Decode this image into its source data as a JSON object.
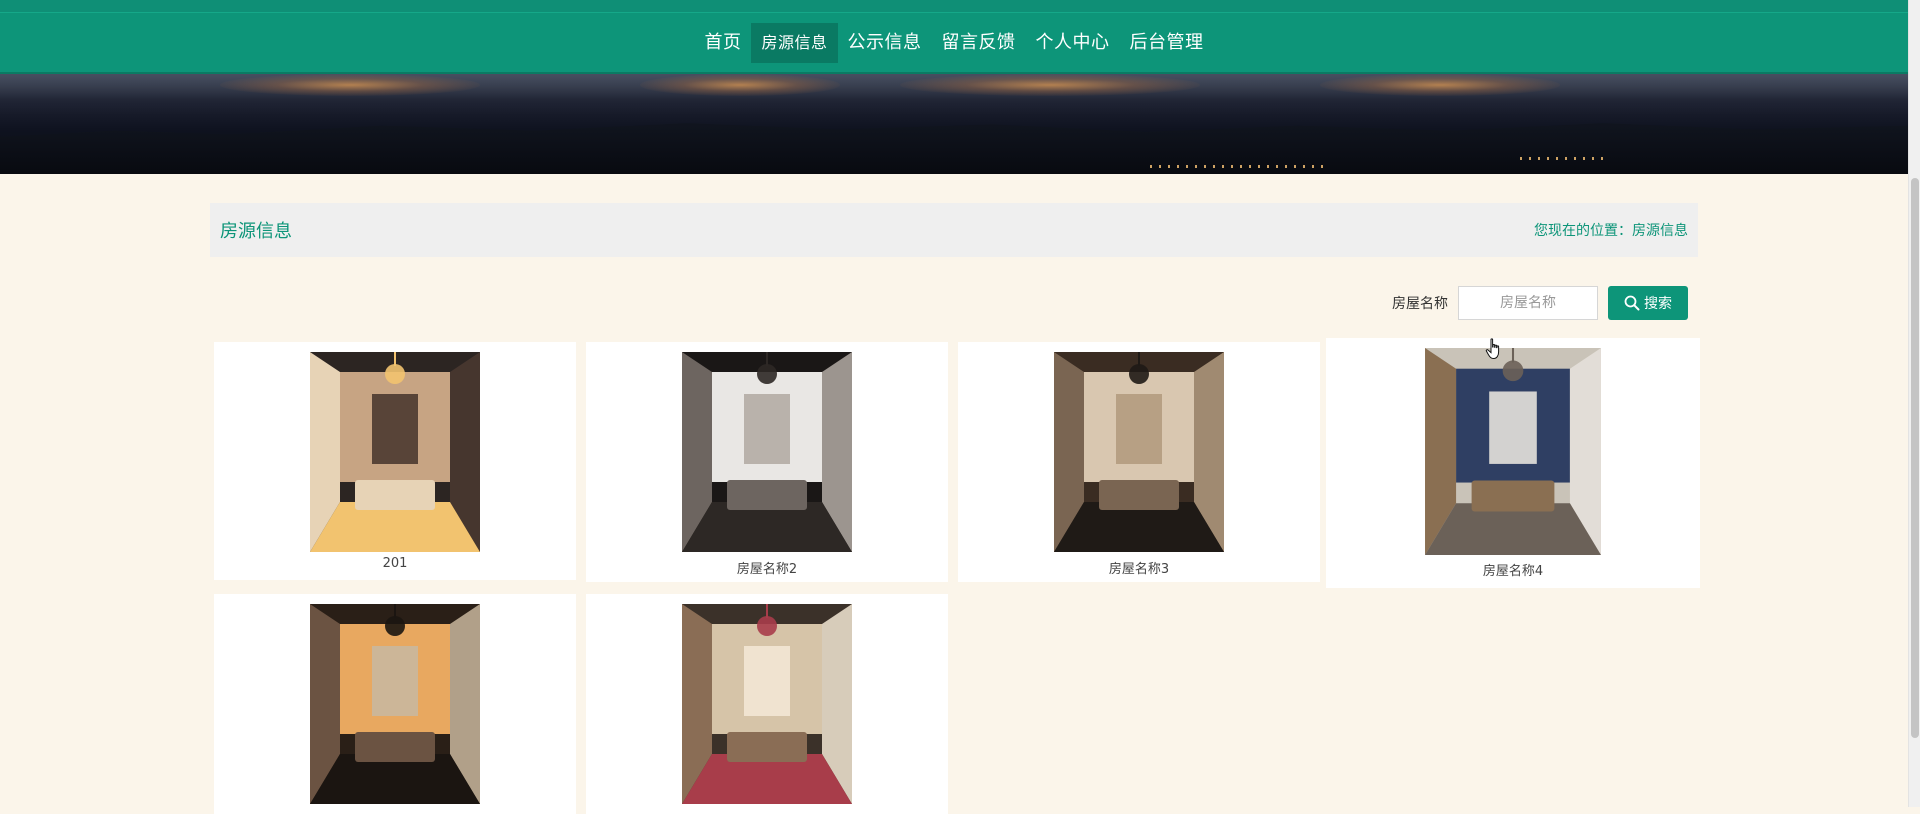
{
  "nav": {
    "items": [
      {
        "label": "首页",
        "active": false
      },
      {
        "label": "房源信息",
        "active": true
      },
      {
        "label": "公示信息",
        "active": false
      },
      {
        "label": "留言反馈",
        "active": false
      },
      {
        "label": "个人中心",
        "active": false
      },
      {
        "label": "后台管理",
        "active": false
      }
    ]
  },
  "section": {
    "title": "房源信息",
    "breadcrumb": "您现在的位置：房源信息"
  },
  "search": {
    "label": "房屋名称",
    "placeholder": "房屋名称",
    "button_label": "搜索"
  },
  "houses": [
    {
      "name": "201",
      "palette": [
        "#2c2522",
        "#c7a483",
        "#e7d3b6",
        "#4b3a30",
        "#f2c36f"
      ]
    },
    {
      "name": "房屋名称2",
      "palette": [
        "#1a1716",
        "#e9e7e4",
        "#6d6560",
        "#b4aca4",
        "#2d2825"
      ]
    },
    {
      "name": "房屋名称3",
      "palette": [
        "#3a2c22",
        "#d9c7b0",
        "#7a6552",
        "#b39b7f",
        "#1f1a16"
      ]
    },
    {
      "name": "房屋名称4",
      "palette": [
        "#c9c3b8",
        "#2f3f63",
        "#8a6f52",
        "#e6e2dc",
        "#6b6158"
      ]
    },
    {
      "name": "",
      "palette": [
        "#2a1f17",
        "#e8a860",
        "#6b5342",
        "#c9b79e",
        "#1b1511"
      ]
    },
    {
      "name": "",
      "palette": [
        "#3b3129",
        "#d6c4a8",
        "#8a6d55",
        "#f3e7d4",
        "#a83d4a"
      ]
    }
  ],
  "colors": {
    "accent": "#0d9579",
    "page_bg": "#fbf5ea"
  }
}
